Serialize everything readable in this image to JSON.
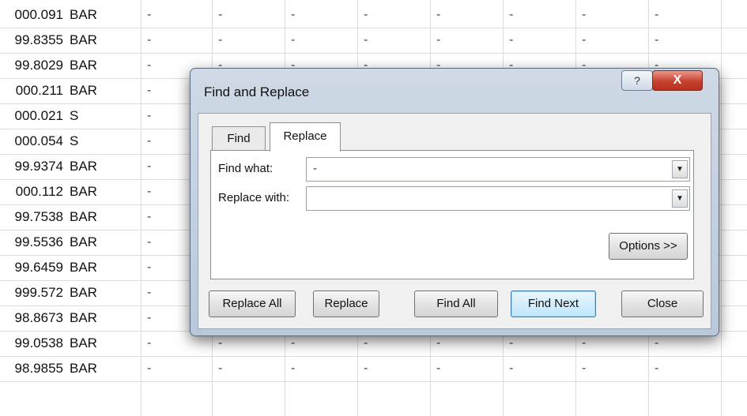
{
  "sheet": {
    "rows": [
      {
        "a": "000.091",
        "b": "BAR"
      },
      {
        "a": "99.8355",
        "b": "BAR"
      },
      {
        "a": "99.8029",
        "b": "BAR"
      },
      {
        "a": "000.211",
        "b": "BAR"
      },
      {
        "a": "000.021",
        "b": "S"
      },
      {
        "a": "000.054",
        "b": "S"
      },
      {
        "a": "99.9374",
        "b": "BAR"
      },
      {
        "a": "000.112",
        "b": "BAR"
      },
      {
        "a": "99.7538",
        "b": "BAR"
      },
      {
        "a": "99.5536",
        "b": "BAR"
      },
      {
        "a": "99.6459",
        "b": "BAR"
      },
      {
        "a": "999.572",
        "b": "BAR"
      },
      {
        "a": "98.8673",
        "b": "BAR"
      },
      {
        "a": "99.0538",
        "b": "BAR"
      },
      {
        "a": "98.9855",
        "b": "BAR"
      }
    ],
    "dash": "-"
  },
  "dialog": {
    "title": "Find and Replace",
    "help_label": "?",
    "close_label": "X",
    "tabs": [
      {
        "label": "Find"
      },
      {
        "label": "Replace"
      }
    ],
    "find_what_label": "Find what:",
    "find_what_value": "-",
    "replace_with_label": "Replace with:",
    "replace_with_value": "",
    "options_label": "Options >>",
    "buttons": {
      "replace_all": "Replace All",
      "replace": "Replace",
      "find_all": "Find All",
      "find_next": "Find Next",
      "close": "Close"
    }
  },
  "colors": {
    "accent": "#c8412f",
    "dialog_frame": "#b9c8db"
  }
}
